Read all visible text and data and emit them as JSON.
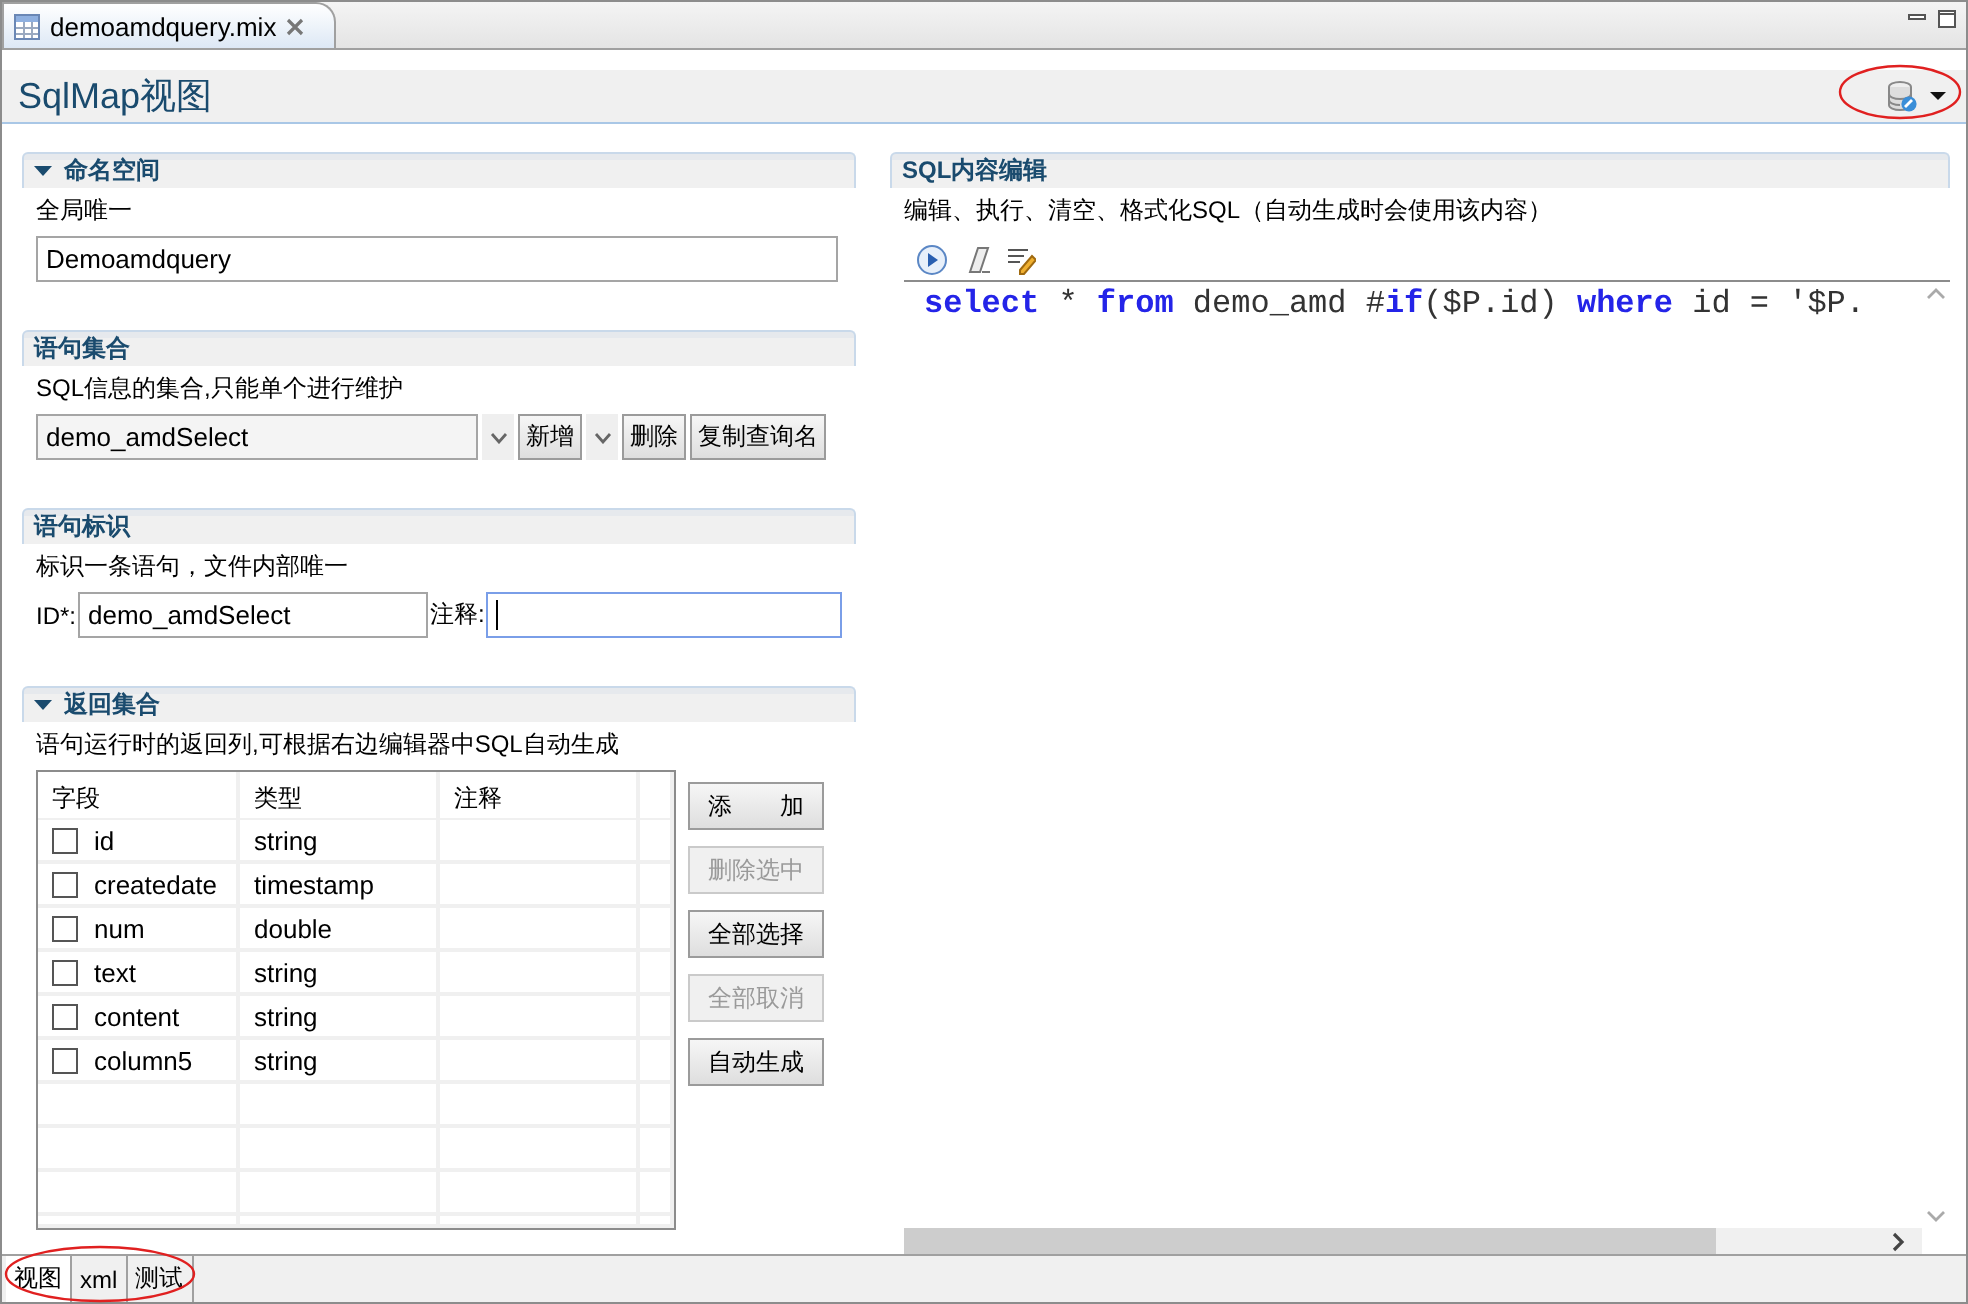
{
  "editor_tab": {
    "title": "demoamdquery.mix",
    "selected": true
  },
  "view_title": "SqlMap视图",
  "namespace": {
    "title": "命名空间",
    "expanded": true,
    "description": "全局唯一",
    "value": "Demoamdquery"
  },
  "statements": {
    "title": "语句集合",
    "description": "SQL信息的集合,只能单个进行维护",
    "selected_statement": "demo_amdSelect",
    "buttons": [
      {
        "label": "新增",
        "kind": "split"
      },
      {
        "label": "删除",
        "kind": "plain"
      },
      {
        "label": "复制查询名",
        "kind": "plain"
      }
    ]
  },
  "identifier": {
    "title": "语句标识",
    "description": "标识一条语句，文件内部唯一",
    "id_label": "ID*:",
    "id_value": "demo_amdSelect",
    "comment_label": "注释:",
    "comment_focused": true
  },
  "result_set": {
    "title": "返回集合",
    "expanded": true,
    "description": "语句运行时的返回列,可根据右边编辑器中SQL自动生成",
    "columns": [
      "字段",
      "类型",
      "注释"
    ],
    "rows": [
      {
        "field": "id",
        "type": "string",
        "checked": false
      },
      {
        "field": "createdate",
        "type": "timestamp",
        "checked": false
      },
      {
        "field": "num",
        "type": "double",
        "checked": false
      },
      {
        "field": "text",
        "type": "string",
        "checked": false
      },
      {
        "field": "content",
        "type": "string",
        "checked": false
      },
      {
        "field": "column5",
        "type": "string",
        "checked": false
      }
    ],
    "buttons": [
      {
        "label": "添　　加",
        "disabled": false
      },
      {
        "label": "删除选中",
        "disabled": true
      },
      {
        "label": "全部选择",
        "disabled": false
      },
      {
        "label": "全部取消",
        "disabled": true
      },
      {
        "label": "自动生成",
        "disabled": false
      }
    ]
  },
  "sql_editor": {
    "title": "SQL内容编辑",
    "description": "编辑、执行、清空、格式化SQL（自动生成时会使用该内容）",
    "code": [
      {
        "text": "select",
        "kind": "keyword"
      },
      {
        "text": " * ",
        "kind": "plain"
      },
      {
        "text": "from",
        "kind": "keyword"
      },
      {
        "text": " demo_amd #",
        "kind": "plain"
      },
      {
        "text": "if",
        "kind": "keyword"
      },
      {
        "text": "($P.id) ",
        "kind": "plain"
      },
      {
        "text": "where",
        "kind": "keyword"
      },
      {
        "text": " id = '$P.",
        "kind": "plain"
      }
    ]
  },
  "bottom_tabs": [
    {
      "label": "视图",
      "selected": true
    },
    {
      "label": "xml",
      "selected": false
    },
    {
      "label": "测试",
      "selected": false
    }
  ]
}
